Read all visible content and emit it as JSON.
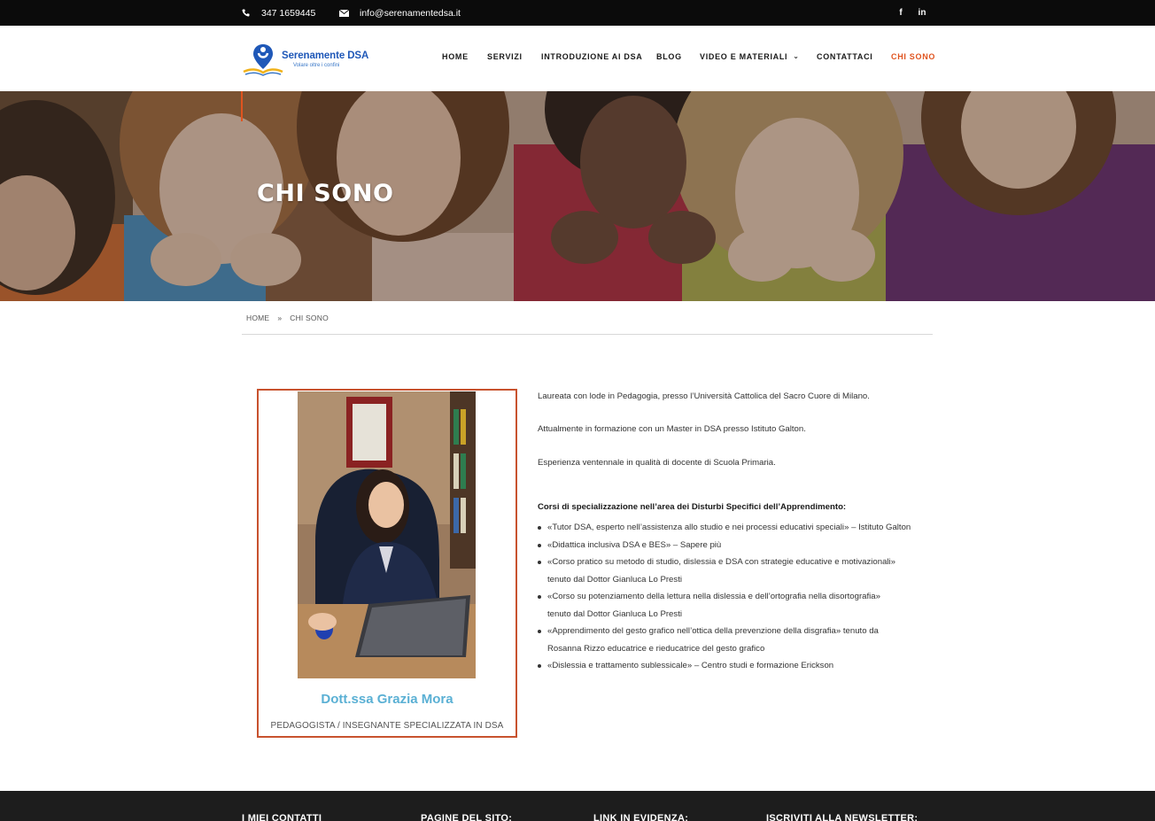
{
  "topbar": {
    "phone": "347 1659445",
    "email": "info@serenamentedsa.it",
    "social": {
      "facebook": "f",
      "linkedin": "in"
    }
  },
  "logo": {
    "name": "Serenamente DSA",
    "tagline": "Volare oltre i confini"
  },
  "nav": {
    "items": [
      {
        "label": "HOME"
      },
      {
        "label": "SERVIZI"
      },
      {
        "label": "INTRODUZIONE AI DSA"
      },
      {
        "label": "BLOG"
      },
      {
        "label": "VIDEO E MATERIALI",
        "dropdown": true
      },
      {
        "label": "CONTATTACI"
      },
      {
        "label": "CHI SONO",
        "active": true
      }
    ]
  },
  "hero": {
    "title": "CHI SONO"
  },
  "breadcrumb": {
    "home": "HOME",
    "separator": "»",
    "current": "CHI SONO"
  },
  "profile": {
    "name": "Dott.ssa Grazia Mora",
    "role": "PEDAGOGISTA / INSEGNANTE SPECIALIZZATA IN DSA"
  },
  "content": {
    "p1": "Laureata con lode in Pedagogia, presso l’Università Cattolica del Sacro Cuore di Milano.",
    "p2": "Attualmente in formazione con un Master in DSA presso Istituto Galton.",
    "p3": "Esperienza ventennale in qualità di docente di Scuola Primaria.",
    "courses_heading": "Corsi di specializzazione nell’area dei Disturbi Specifici dell’Apprendimento:",
    "courses": [
      [
        "«Tutor DSA, esperto nell’assistenza allo studio e nei processi educativi speciali» – Istituto Galton"
      ],
      [
        "«Didattica inclusiva DSA e BES» – Sapere più"
      ],
      [
        "«Corso pratico su metodo di studio, dislessia e DSA con strategie educative e motivazionali»",
        "tenuto dal Dottor Gianluca Lo Presti"
      ],
      [
        "«Corso su potenziamento della lettura nella dislessia e dell’ortografia nella disortografia»",
        "tenuto dal Dottor Gianluca Lo Presti"
      ],
      [
        "«Apprendimento del gesto grafico nell’ottica della prevenzione della disgrafia» tenuto da",
        "Rosanna Rizzo educatrice e rieducatrice del gesto grafico"
      ],
      [
        "«Dislessia e trattamento sublessicale» – Centro studi e formazione Erickson"
      ]
    ]
  },
  "footer": {
    "headings": [
      "I MIEI CONTATTI",
      "PAGINE DEL SITO:",
      "LINK IN EVIDENZA:",
      "ISCRIVITI ALLA NEWSLETTER:"
    ]
  },
  "colors": {
    "accent": "#e0541f",
    "name": "#5ab0d4",
    "card_border": "#c8522e",
    "brand_blue": "#1f58b8"
  }
}
